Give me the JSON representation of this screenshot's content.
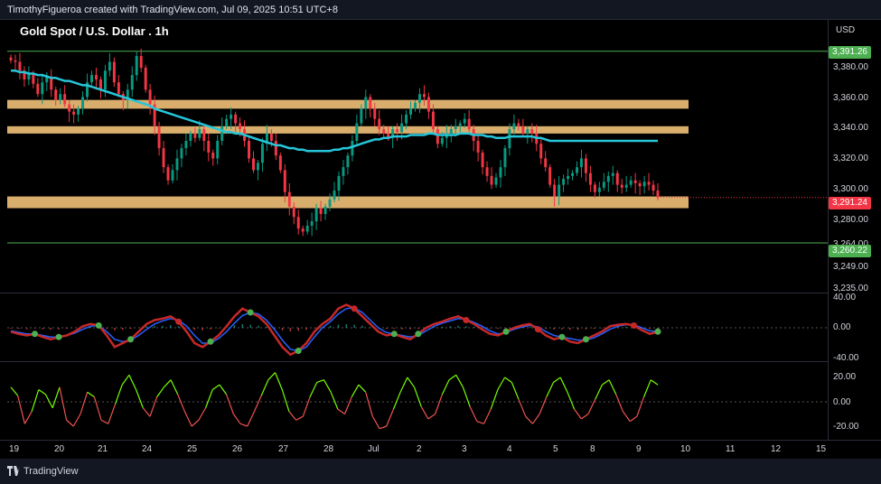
{
  "header": {
    "creator_line": "TimothyFigueroa created with TradingView.com, Jul 09, 2025 10:51 UTC+8",
    "symbol_title": "Gold Spot / U.S. Dollar . 1h",
    "currency": "USD"
  },
  "price_axis": {
    "ticks": [
      "3,380.00",
      "3,360.00",
      "3,340.00",
      "3,320.00",
      "3,300.00",
      "3,280.00",
      "3,264.00",
      "3,249.00",
      "3,235.00"
    ],
    "tags": [
      {
        "label": "3,391.26",
        "color": "#4caf50"
      },
      {
        "label": "3,291.24",
        "color": "#f23645"
      },
      {
        "label": "3,260.22",
        "color": "#4caf50"
      }
    ]
  },
  "osc1_axis": {
    "ticks": [
      "40.00",
      "0.00",
      "-40.00"
    ]
  },
  "osc2_axis": {
    "ticks": [
      "20.00",
      "0.00",
      "-20.00"
    ]
  },
  "time_axis": {
    "labels": [
      "19",
      "20",
      "21",
      "24",
      "25",
      "26",
      "27",
      "28",
      "Jul",
      "2",
      "3",
      "4",
      "5",
      "8",
      "9",
      "10",
      "11",
      "12",
      "15"
    ]
  },
  "chart_data": {
    "type": "line",
    "price": {
      "x": [
        0,
        1,
        2,
        3,
        4,
        5,
        6,
        7,
        8,
        9,
        10,
        11,
        12,
        13,
        14,
        15,
        16,
        17,
        18,
        19,
        20,
        21,
        22,
        23,
        24,
        25,
        26,
        27,
        28,
        29,
        30,
        31,
        32,
        33,
        34,
        35,
        36,
        37,
        38,
        39,
        40,
        41,
        42,
        43,
        44,
        45,
        46,
        47,
        48,
        49,
        50,
        51,
        52,
        53,
        54,
        55,
        56,
        57,
        58,
        59,
        60,
        61,
        62,
        63,
        64,
        65,
        66,
        67,
        68,
        69,
        70,
        71,
        72,
        73,
        74,
        75,
        76,
        77,
        78,
        79,
        80,
        81,
        82,
        83,
        84,
        85,
        86,
        87,
        88,
        89,
        90,
        91,
        92,
        93,
        94,
        95,
        96,
        97,
        98,
        99,
        100,
        101,
        102,
        103,
        104,
        105,
        106,
        107,
        108,
        109,
        110,
        111,
        112,
        113,
        114,
        115,
        116,
        117,
        118,
        119,
        120,
        121,
        122,
        123,
        124,
        125,
        126,
        127,
        128,
        129,
        130,
        131,
        132,
        133,
        134,
        135,
        136,
        137,
        138,
        139,
        140,
        141,
        142,
        143,
        144
      ],
      "close": [
        3385,
        3384,
        3378,
        3372,
        3376,
        3369,
        3362,
        3370,
        3374,
        3365,
        3358,
        3362,
        3355,
        3350,
        3348,
        3352,
        3360,
        3370,
        3375,
        3372,
        3365,
        3378,
        3384,
        3370,
        3362,
        3358,
        3365,
        3375,
        3388,
        3380,
        3365,
        3355,
        3340,
        3325,
        3312,
        3303,
        3310,
        3318,
        3325,
        3330,
        3335,
        3332,
        3338,
        3330,
        3322,
        3318,
        3330,
        3340,
        3345,
        3348,
        3342,
        3338,
        3330,
        3318,
        3310,
        3315,
        3328,
        3335,
        3330,
        3320,
        3310,
        3295,
        3285,
        3278,
        3270,
        3268,
        3272,
        3275,
        3284,
        3280,
        3285,
        3290,
        3296,
        3306,
        3312,
        3320,
        3330,
        3342,
        3352,
        3360,
        3352,
        3345,
        3338,
        3335,
        3332,
        3338,
        3336,
        3342,
        3348,
        3352,
        3356,
        3362,
        3360,
        3350,
        3338,
        3328,
        3332,
        3335,
        3338,
        3340,
        3342,
        3345,
        3338,
        3330,
        3322,
        3312,
        3306,
        3300,
        3305,
        3312,
        3325,
        3338,
        3342,
        3340,
        3335,
        3338,
        3335,
        3328,
        3318,
        3312,
        3300,
        3292,
        3300,
        3304,
        3306,
        3308,
        3312,
        3318,
        3308,
        3300,
        3295,
        3298,
        3302,
        3306,
        3308,
        3300,
        3298,
        3300,
        3303,
        3301,
        3299,
        3302,
        3300,
        3296,
        3291.24
      ],
      "ma": [
        3378,
        3378,
        3377,
        3377,
        3376,
        3376,
        3375,
        3375,
        3374,
        3373,
        3373,
        3372,
        3371,
        3371,
        3370,
        3369,
        3368,
        3368,
        3367,
        3366,
        3365,
        3364,
        3363,
        3362,
        3361,
        3360,
        3359,
        3358,
        3357,
        3356,
        3355,
        3354,
        3352,
        3351,
        3350,
        3349,
        3348,
        3347,
        3346,
        3345,
        3344,
        3343,
        3342,
        3341,
        3340,
        3339,
        3338,
        3337,
        3336,
        3336,
        3335,
        3335,
        3334,
        3333,
        3332,
        3331,
        3330,
        3329,
        3328,
        3327,
        3327,
        3326,
        3325,
        3325,
        3324,
        3324,
        3323,
        3323,
        3323,
        3323,
        3323,
        3323,
        3324,
        3324,
        3325,
        3325,
        3326,
        3327,
        3328,
        3329,
        3330,
        3331,
        3331,
        3332,
        3332,
        3333,
        3333,
        3333,
        3333,
        3334,
        3334,
        3334,
        3334,
        3335,
        3335,
        3334,
        3334,
        3334,
        3334,
        3334,
        3335,
        3335,
        3335,
        3334,
        3334,
        3334,
        3333,
        3333,
        3332,
        3332,
        3332,
        3333,
        3333,
        3333,
        3333,
        3333,
        3333,
        3332,
        3332,
        3331,
        3330,
        3330,
        3330,
        3330,
        3330,
        3330,
        3330,
        3330,
        3330,
        3330,
        3330,
        3330,
        3330,
        3330,
        3330,
        3330,
        3330,
        3330,
        3330,
        3330,
        3330,
        3330,
        3330,
        3330,
        3330
      ],
      "zones": [
        [
          3352,
          3358
        ],
        [
          3335,
          3340
        ],
        [
          3284,
          3292
        ]
      ],
      "levels": [
        3391.26,
        3260.22
      ],
      "last": 3291.24
    },
    "osc1": {
      "fast": [
        -5,
        -8,
        -10,
        -8,
        -12,
        -15,
        -12,
        -10,
        -5,
        2,
        5,
        3,
        -10,
        -25,
        -20,
        -15,
        -5,
        5,
        10,
        12,
        15,
        8,
        -5,
        -20,
        -25,
        -18,
        -10,
        2,
        15,
        25,
        20,
        15,
        5,
        -10,
        -25,
        -35,
        -30,
        -20,
        -5,
        5,
        12,
        25,
        30,
        25,
        15,
        5,
        -5,
        -10,
        -8,
        -12,
        -15,
        -8,
        0,
        5,
        8,
        12,
        15,
        10,
        5,
        -2,
        -8,
        -10,
        -5,
        0,
        3,
        5,
        -2,
        -10,
        -15,
        -12,
        -18,
        -20,
        -15,
        -10,
        -5,
        2,
        4,
        5,
        3,
        -3,
        -8,
        -5
      ],
      "slow": [
        -4,
        -6,
        -8,
        -8,
        -10,
        -12,
        -12,
        -10,
        -7,
        -2,
        2,
        3,
        -5,
        -15,
        -18,
        -16,
        -10,
        -2,
        5,
        9,
        12,
        10,
        2,
        -10,
        -20,
        -20,
        -14,
        -5,
        6,
        16,
        20,
        18,
        10,
        -2,
        -16,
        -28,
        -30,
        -25,
        -12,
        0,
        8,
        18,
        25,
        26,
        20,
        10,
        0,
        -6,
        -8,
        -10,
        -12,
        -10,
        -4,
        2,
        6,
        9,
        12,
        11,
        7,
        2,
        -4,
        -8,
        -6,
        -2,
        1,
        3,
        1,
        -5,
        -10,
        -12,
        -14,
        -16,
        -16,
        -13,
        -8,
        -2,
        2,
        4,
        4,
        0,
        -4,
        -5
      ],
      "hist": [
        -3,
        -4,
        -5,
        -2,
        -6,
        -8,
        -6,
        -4,
        0,
        4,
        6,
        4,
        -4,
        -10,
        -8,
        -4,
        0,
        6,
        8,
        8,
        10,
        6,
        -2,
        -8,
        -10,
        -6,
        -2,
        4,
        10,
        14,
        12,
        8,
        4,
        -4,
        -10,
        -14,
        -12,
        -8,
        -2,
        4,
        8,
        12,
        14,
        12,
        8,
        2,
        -2,
        -4,
        -4,
        -6,
        -6,
        -4,
        0,
        2,
        4,
        6,
        8,
        6,
        4,
        0,
        -2,
        -4,
        -2,
        0,
        2,
        4,
        0,
        -4,
        -6,
        -6,
        -8,
        -8,
        -6,
        -4,
        -2,
        2,
        4,
        4,
        2,
        -2,
        -4,
        -4
      ],
      "ylim": [
        -50,
        50
      ]
    },
    "osc2": {
      "values": [
        12,
        5,
        -18,
        -8,
        10,
        6,
        -5,
        12,
        -15,
        -20,
        -10,
        8,
        4,
        -15,
        -18,
        -2,
        14,
        22,
        10,
        -5,
        -12,
        4,
        12,
        18,
        6,
        -8,
        -20,
        -15,
        -5,
        10,
        14,
        6,
        -10,
        -18,
        -20,
        -8,
        5,
        18,
        24,
        10,
        -8,
        -15,
        -12,
        4,
        16,
        18,
        8,
        -6,
        -10,
        4,
        14,
        8,
        -12,
        -22,
        -20,
        -6,
        8,
        20,
        12,
        -4,
        -14,
        -10,
        6,
        18,
        22,
        12,
        -4,
        -16,
        -18,
        -6,
        10,
        20,
        16,
        2,
        -12,
        -18,
        -10,
        4,
        16,
        20,
        8,
        -6,
        -14,
        -10,
        2,
        14,
        18,
        6,
        -8,
        -16,
        -12,
        4,
        18,
        14
      ],
      "ylim": [
        -30,
        30
      ]
    },
    "grid": false
  },
  "colors": {
    "up": "#089981",
    "down": "#f23645",
    "ma": "#26c6da",
    "zone": "#ffcc80",
    "level": "#4caf50",
    "osc_green": "#4caf50",
    "osc_blue": "#2962ff",
    "osc_red": "#c62828"
  },
  "footer": {
    "brand": "TradingView"
  }
}
